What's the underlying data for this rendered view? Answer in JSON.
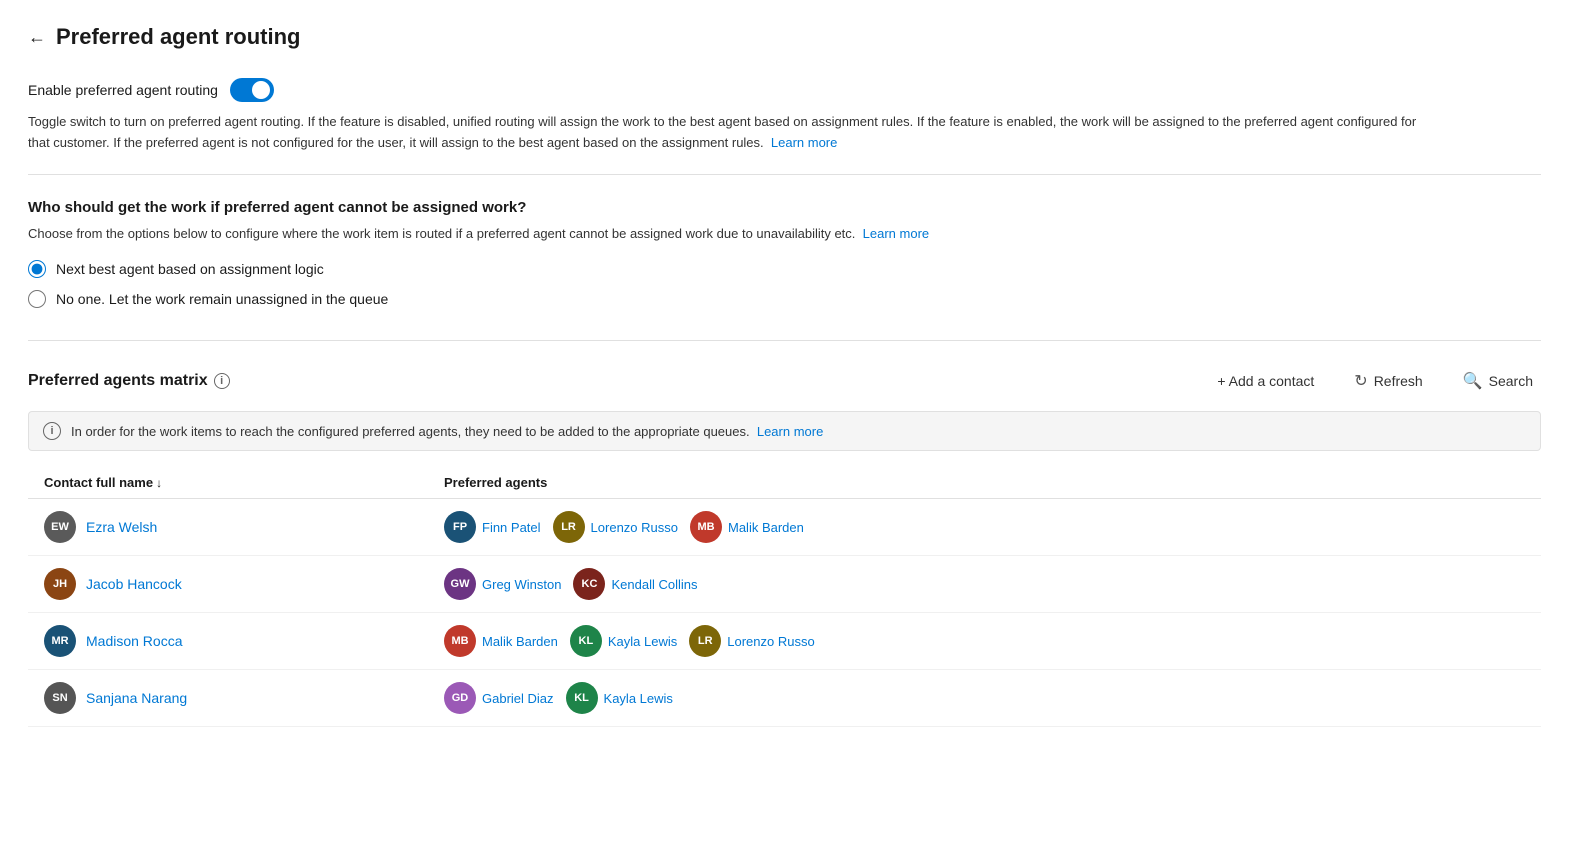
{
  "page": {
    "title": "Preferred agent routing",
    "back_label": "←"
  },
  "toggle_section": {
    "label": "Enable preferred agent routing",
    "enabled": true,
    "description": "Toggle switch to turn on preferred agent routing. If the feature is disabled, unified routing will assign the work to the best agent based on assignment rules. If the feature is enabled, the work will be assigned to the preferred agent configured for that customer. If the preferred agent is not configured for the user, it will assign to the best agent based on the assignment rules.",
    "learn_more": "Learn more"
  },
  "routing_section": {
    "title": "Who should get the work if preferred agent cannot be assigned work?",
    "description": "Choose from the options below to configure where the work item is routed if a preferred agent cannot be assigned work due to unavailability etc.",
    "learn_more": "Learn more",
    "options": [
      {
        "id": "opt1",
        "label": "Next best agent based on assignment logic",
        "checked": true
      },
      {
        "id": "opt2",
        "label": "No one. Let the work remain unassigned in the queue",
        "checked": false
      }
    ]
  },
  "matrix_section": {
    "title": "Preferred agents matrix",
    "info_tooltip": "i",
    "actions": {
      "add": "+ Add a contact",
      "refresh": "Refresh",
      "search": "Search"
    },
    "notice": "In order for the work items to reach the configured preferred agents, they need to be added to the appropriate queues.",
    "notice_learn_more": "Learn more",
    "table": {
      "columns": [
        "Contact full name",
        "Preferred agents"
      ],
      "rows": [
        {
          "contact": {
            "initials": "EW",
            "name": "Ezra Welsh",
            "color": "#5a5a5a"
          },
          "agents": [
            {
              "initials": "FP",
              "name": "Finn Patel",
              "color": "#1a5276"
            },
            {
              "initials": "LR",
              "name": "Lorenzo Russo",
              "color": "#7d6608"
            },
            {
              "initials": "MB",
              "name": "Malik Barden",
              "color": "#c0392b"
            }
          ]
        },
        {
          "contact": {
            "initials": "JH",
            "name": "Jacob Hancock",
            "color": "#8B4513"
          },
          "agents": [
            {
              "initials": "GW",
              "name": "Greg Winston",
              "color": "#6c3483"
            },
            {
              "initials": "KC",
              "name": "Kendall Collins",
              "color": "#7b241c"
            }
          ]
        },
        {
          "contact": {
            "initials": "MR",
            "name": "Madison Rocca",
            "color": "#1a5276"
          },
          "agents": [
            {
              "initials": "MB",
              "name": "Malik Barden",
              "color": "#c0392b"
            },
            {
              "initials": "KL",
              "name": "Kayla Lewis",
              "color": "#1e8449"
            },
            {
              "initials": "LR",
              "name": "Lorenzo Russo",
              "color": "#7d6608"
            }
          ]
        },
        {
          "contact": {
            "initials": "SN",
            "name": "Sanjana Narang",
            "color": "#555555"
          },
          "agents": [
            {
              "initials": "GD",
              "name": "Gabriel Diaz",
              "color": "#9b59b6"
            },
            {
              "initials": "KL",
              "name": "Kayla Lewis",
              "color": "#1e8449"
            }
          ]
        }
      ]
    }
  }
}
